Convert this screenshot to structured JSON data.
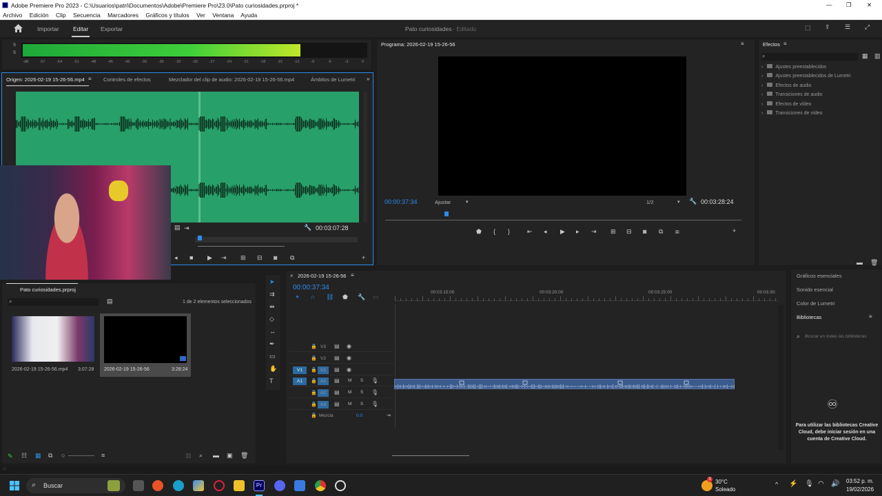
{
  "window": {
    "title": "Adobe Premiere Pro 2023 - C:\\Usuarios\\patri\\Documentos\\Adobe\\Premiere Pro\\23.0\\Pato curiosidades.prproj *",
    "min": "—",
    "max": "❐",
    "close": "✕"
  },
  "menu": [
    "Archivo",
    "Edición",
    "Clip",
    "Secuencia",
    "Marcadores",
    "Gráficos y títulos",
    "Ver",
    "Ventana",
    "Ayuda"
  ],
  "header": {
    "tabs": [
      "Importar",
      "Editar",
      "Exportar"
    ],
    "active_tab": "Editar",
    "project": "Pato curiosidades",
    "state": "- Editado"
  },
  "audio_meter": {
    "scale": [
      "-dB",
      "-57",
      "-54",
      "-51",
      "-48",
      "-45",
      "-42",
      "-39",
      "-36",
      "-33",
      "-30",
      "-27",
      "-24",
      "-21",
      "-18",
      "-15",
      "-12",
      "-9",
      "-6",
      "-3",
      "0"
    ],
    "channels": [
      "S",
      "S"
    ],
    "level_fraction": 0.81
  },
  "source": {
    "tabs": [
      "Origen: 2026-02-19 15-26-56.mp4",
      "Controles de efectos",
      "Mezclador del clip de audio: 2026-02-19 15-26-56.mp4",
      "Ámbitos de Lumetri"
    ],
    "timecode": "00:03:07:28"
  },
  "program": {
    "title": "Programa: 2026-02-19 15-26-56",
    "timecode": "00:00:37:34",
    "fit": "Ajustar",
    "scale": "1/2",
    "duration": "00:03:28:24"
  },
  "effects": {
    "title": "Efectos",
    "items": [
      "Ajustes preestablecidos",
      "Ajustes preestablecidos de Lumetri",
      "Efectos de audio",
      "Transiciones de audio",
      "Efectos de vídeo",
      "Transiciones de vídeo"
    ]
  },
  "project": {
    "title": "Pato curiosidades.prproj",
    "selection": "1 de 2 elementos seleccionados",
    "items": [
      {
        "name": "2026-02-19 15-26-56.mp4",
        "duration": "3:07:28"
      },
      {
        "name": "2026-02-19 15-26-56",
        "duration": "3:28:24"
      }
    ]
  },
  "timeline": {
    "sequence": "2026-02-19 15-26-56",
    "timecode": "00:00:37:34",
    "ruler": [
      "00:03:15:00",
      "00:03:20:00",
      "00:03:25:00",
      "00:03:30:"
    ],
    "video_tracks": [
      "V3",
      "V2",
      "V1"
    ],
    "audio_tracks": [
      "A1",
      "A2",
      "A3"
    ],
    "src_v": "V1",
    "src_a": "A1",
    "mix_label": "Mezcla",
    "mix_value": "0.0",
    "m": "M",
    "s": "S"
  },
  "right_panels": {
    "items": [
      "Gráficos esenciales",
      "Sonido esencial",
      "Color de Lumetri",
      "Bibliotecas"
    ],
    "search_placeholder": "Buscar en todas las bibliotecas",
    "cc_message": "Para utilizar las bibliotecas Creative Cloud, debe iniciar sesión en una cuenta de Creative Cloud."
  },
  "taskbar": {
    "search": "Buscar",
    "weather_temp": "30°C",
    "weather_text": "Soleado",
    "badge": "3",
    "time": "03:52 p. m.",
    "date": "19/02/2026"
  },
  "colors": {
    "accent": "#2d8ceb",
    "clip_green": "#28a06a",
    "audio_clip": "#3a5a8c"
  }
}
